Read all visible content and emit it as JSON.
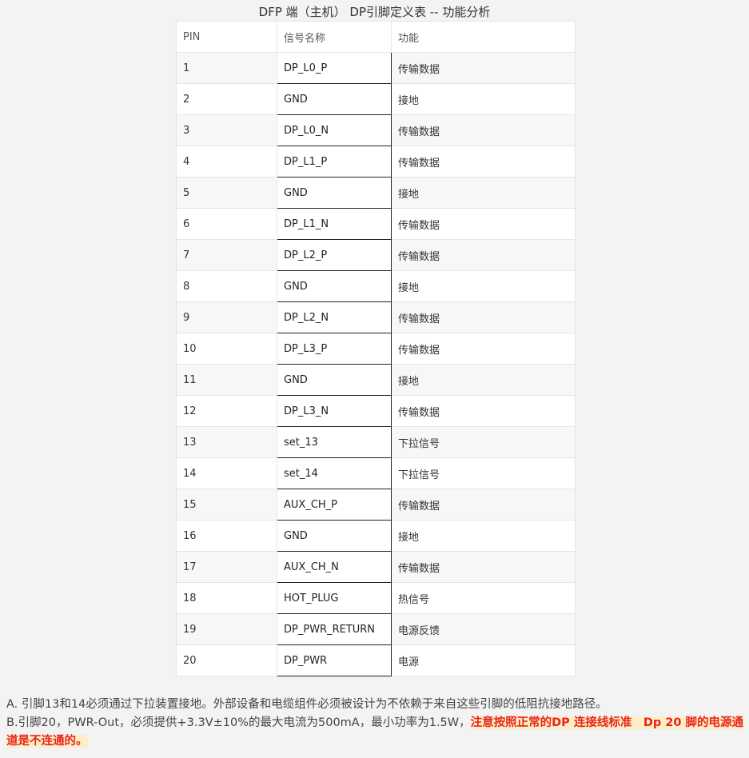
{
  "caption": "DFP 端（主机） DP引脚定义表 -- 功能分析",
  "table": {
    "headers": [
      "PIN",
      "信号名称",
      "功能"
    ],
    "rows": [
      [
        "1",
        "DP_L0_P",
        "传输数据"
      ],
      [
        "2",
        "GND",
        "接地"
      ],
      [
        "3",
        "DP_L0_N",
        "传输数据"
      ],
      [
        "4",
        "DP_L1_P",
        "传输数据"
      ],
      [
        "5",
        "GND",
        "接地"
      ],
      [
        "6",
        "DP_L1_N",
        "传输数据"
      ],
      [
        "7",
        "DP_L2_P",
        "传输数据"
      ],
      [
        "8",
        "GND",
        "接地"
      ],
      [
        "9",
        "DP_L2_N",
        "传输数据"
      ],
      [
        "10",
        "DP_L3_P",
        "传输数据"
      ],
      [
        "11",
        "GND",
        "接地"
      ],
      [
        "12",
        "DP_L3_N",
        "传输数据"
      ],
      [
        "13",
        "set_13",
        "下拉信号"
      ],
      [
        "14",
        "set_14",
        "下拉信号"
      ],
      [
        "15",
        "AUX_CH_P",
        "传输数据"
      ],
      [
        "16",
        "GND",
        "接地"
      ],
      [
        "17",
        "AUX_CH_N",
        "传输数据"
      ],
      [
        "18",
        "HOT_PLUG",
        "热信号"
      ],
      [
        "19",
        "DP_PWR_RETURN",
        "电源反馈"
      ],
      [
        "20",
        "DP_PWR",
        "电源"
      ]
    ]
  },
  "notes": {
    "a": "A. 引脚13和14必须通过下拉装置接地。外部设备和电缆组件必须被设计为不依赖于来自这些引脚的低阻抗接地路径。",
    "b_plain": "B.引脚20，PWR-Out，必须提供+3.3V±10%的最大电流为500mA，最小功率为1.5W，",
    "b_highlight": "注意按照正常的DP 连接线标准　Dp 20 脚的电源通道是不连通的。"
  },
  "colors": {
    "highlight_text": "#e8251d",
    "highlight_bg": "#fdeec6",
    "page_bg": "#f3f3f4"
  }
}
